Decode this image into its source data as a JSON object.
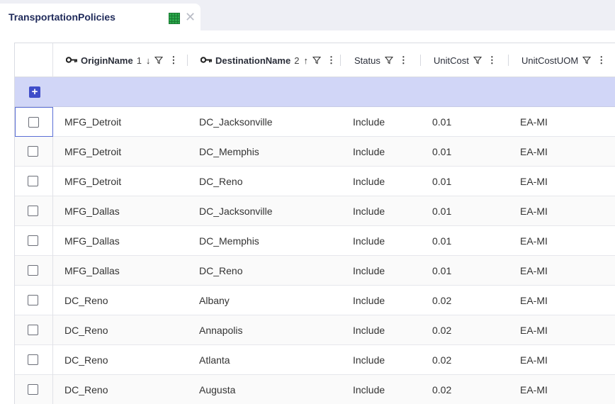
{
  "tab": {
    "title": "TransportationPolicies",
    "grid_icon": "grid-table-icon",
    "close_icon": "close-icon",
    "grid_icon_color": "#2aa84a"
  },
  "columns": [
    {
      "key": "origin",
      "label": "OriginName",
      "is_key": true,
      "sort_order": "1",
      "sort_dir": "↓"
    },
    {
      "key": "destination",
      "label": "DestinationName",
      "is_key": true,
      "sort_order": "2",
      "sort_dir": "↑"
    },
    {
      "key": "status",
      "label": "Status"
    },
    {
      "key": "unitcost",
      "label": "UnitCost"
    },
    {
      "key": "uom",
      "label": "UnitCostUOM"
    }
  ],
  "add_row": {
    "icon": "plus-icon",
    "color": "#3f4dc9"
  },
  "colors": {
    "accent": "#3f4dc9",
    "add_row_bg": "#d1d6f7",
    "tab_title": "#1f2a5a"
  },
  "rows": [
    {
      "origin": "MFG_Detroit",
      "destination": "DC_Jacksonville",
      "status": "Include",
      "unitcost": "0.01",
      "uom": "EA-MI"
    },
    {
      "origin": "MFG_Detroit",
      "destination": "DC_Memphis",
      "status": "Include",
      "unitcost": "0.01",
      "uom": "EA-MI"
    },
    {
      "origin": "MFG_Detroit",
      "destination": "DC_Reno",
      "status": "Include",
      "unitcost": "0.01",
      "uom": "EA-MI"
    },
    {
      "origin": "MFG_Dallas",
      "destination": "DC_Jacksonville",
      "status": "Include",
      "unitcost": "0.01",
      "uom": "EA-MI"
    },
    {
      "origin": "MFG_Dallas",
      "destination": "DC_Memphis",
      "status": "Include",
      "unitcost": "0.01",
      "uom": "EA-MI"
    },
    {
      "origin": "MFG_Dallas",
      "destination": "DC_Reno",
      "status": "Include",
      "unitcost": "0.01",
      "uom": "EA-MI"
    },
    {
      "origin": "DC_Reno",
      "destination": "Albany",
      "status": "Include",
      "unitcost": "0.02",
      "uom": "EA-MI"
    },
    {
      "origin": "DC_Reno",
      "destination": "Annapolis",
      "status": "Include",
      "unitcost": "0.02",
      "uom": "EA-MI"
    },
    {
      "origin": "DC_Reno",
      "destination": "Atlanta",
      "status": "Include",
      "unitcost": "0.02",
      "uom": "EA-MI"
    },
    {
      "origin": "DC_Reno",
      "destination": "Augusta",
      "status": "Include",
      "unitcost": "0.02",
      "uom": "EA-MI"
    }
  ]
}
